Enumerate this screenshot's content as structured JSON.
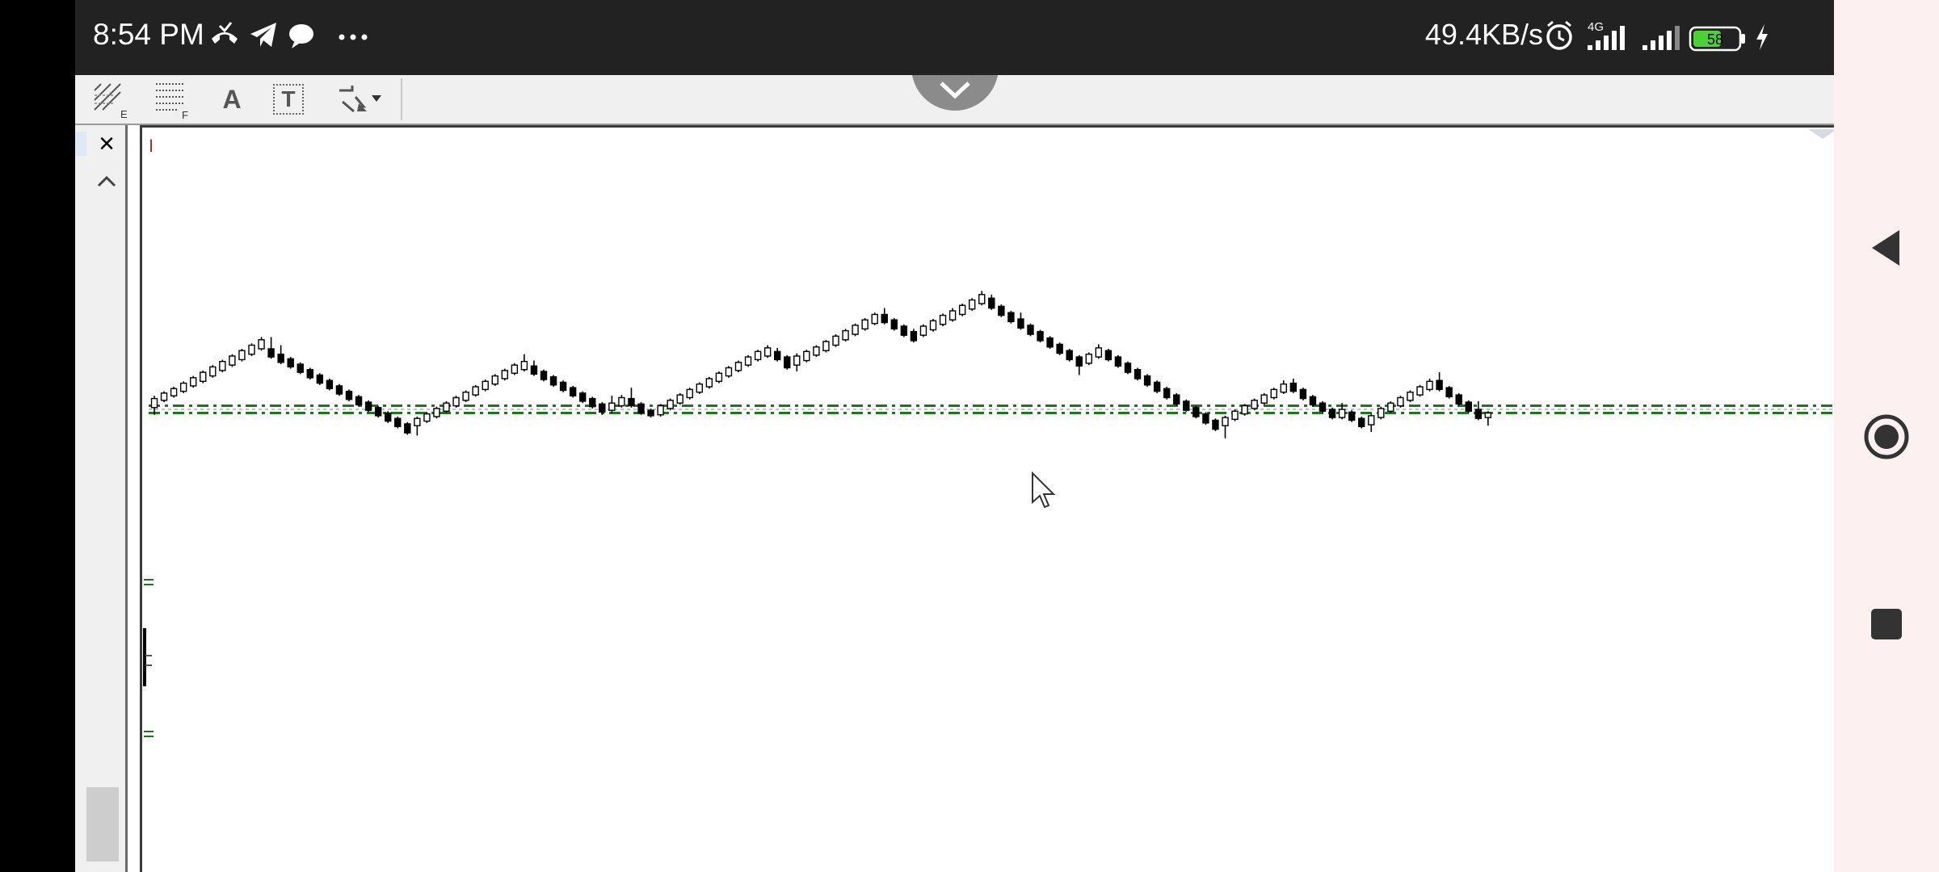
{
  "status_bar": {
    "time": "8:54 PM",
    "net_speed": "49.4KB/s",
    "network_type": "4G",
    "battery": "58",
    "icons": [
      "missed-call-icon",
      "telegram-icon",
      "chat-bubble-icon",
      "more-dots-icon",
      "alarm-icon",
      "signal-4g-icon",
      "signal-icon",
      "battery-icon",
      "charging-icon"
    ]
  },
  "toolbar": {
    "tools": [
      "fibonacci-expansion-icon",
      "fibonacci-fan-icon",
      "text-tool-icon",
      "text-label-tool-icon",
      "arrows-tool-icon"
    ],
    "text_tool_label": "A",
    "text_label_tool_label": "T"
  },
  "sidebar": {
    "close_label": "×"
  },
  "chart_data": {
    "type": "candlestick",
    "grid": false,
    "note_marker": "I",
    "horizontal_levels_color": "#1a7a1a",
    "candles": [
      {
        "o": 20,
        "c": 40,
        "h": 46,
        "l": 4
      },
      {
        "o": 36,
        "c": 52,
        "h": 56,
        "l": 32
      },
      {
        "o": 46,
        "c": 62,
        "h": 66,
        "l": 42
      },
      {
        "o": 56,
        "c": 74,
        "h": 78,
        "l": 52
      },
      {
        "o": 68,
        "c": 86,
        "h": 90,
        "l": 64
      },
      {
        "o": 78,
        "c": 98,
        "h": 102,
        "l": 74
      },
      {
        "o": 90,
        "c": 110,
        "h": 114,
        "l": 86
      },
      {
        "o": 102,
        "c": 122,
        "h": 126,
        "l": 98
      },
      {
        "o": 114,
        "c": 134,
        "h": 138,
        "l": 110
      },
      {
        "o": 126,
        "c": 146,
        "h": 150,
        "l": 122
      },
      {
        "o": 138,
        "c": 158,
        "h": 162,
        "l": 134
      },
      {
        "o": 150,
        "c": 170,
        "h": 176,
        "l": 146
      },
      {
        "o": 150,
        "c": 132,
        "h": 176,
        "l": 128
      },
      {
        "o": 138,
        "c": 120,
        "h": 158,
        "l": 116
      },
      {
        "o": 128,
        "c": 110,
        "h": 132,
        "l": 106
      },
      {
        "o": 116,
        "c": 98,
        "h": 120,
        "l": 94
      },
      {
        "o": 104,
        "c": 86,
        "h": 108,
        "l": 82
      },
      {
        "o": 92,
        "c": 74,
        "h": 96,
        "l": 70
      },
      {
        "o": 80,
        "c": 62,
        "h": 84,
        "l": 58
      },
      {
        "o": 68,
        "c": 50,
        "h": 72,
        "l": 46
      },
      {
        "o": 56,
        "c": 38,
        "h": 60,
        "l": 34
      },
      {
        "o": 44,
        "c": 26,
        "h": 48,
        "l": 22
      },
      {
        "o": 32,
        "c": 14,
        "h": 36,
        "l": 10
      },
      {
        "o": 20,
        "c": 2,
        "h": 24,
        "l": -2
      },
      {
        "o": 8,
        "c": -10,
        "h": 12,
        "l": -14
      },
      {
        "o": -4,
        "c": -22,
        "h": 0,
        "l": -26
      },
      {
        "o": -16,
        "c": -36,
        "h": -12,
        "l": -40
      },
      {
        "o": -20,
        "c": -4,
        "h": 0,
        "l": -42
      },
      {
        "o": -10,
        "c": 6,
        "h": 10,
        "l": -14
      },
      {
        "o": 0,
        "c": 18,
        "h": 22,
        "l": -4
      },
      {
        "o": 12,
        "c": 30,
        "h": 34,
        "l": 8
      },
      {
        "o": 24,
        "c": 42,
        "h": 46,
        "l": 20
      },
      {
        "o": 36,
        "c": 54,
        "h": 58,
        "l": 32
      },
      {
        "o": 48,
        "c": 66,
        "h": 70,
        "l": 44
      },
      {
        "o": 60,
        "c": 78,
        "h": 82,
        "l": 56
      },
      {
        "o": 72,
        "c": 90,
        "h": 94,
        "l": 68
      },
      {
        "o": 84,
        "c": 102,
        "h": 106,
        "l": 80
      },
      {
        "o": 96,
        "c": 114,
        "h": 118,
        "l": 92
      },
      {
        "o": 104,
        "c": 122,
        "h": 138,
        "l": 100
      },
      {
        "o": 112,
        "c": 94,
        "h": 124,
        "l": 90
      },
      {
        "o": 100,
        "c": 82,
        "h": 104,
        "l": 78
      },
      {
        "o": 88,
        "c": 70,
        "h": 92,
        "l": 66
      },
      {
        "o": 76,
        "c": 58,
        "h": 80,
        "l": 54
      },
      {
        "o": 64,
        "c": 46,
        "h": 68,
        "l": 42
      },
      {
        "o": 52,
        "c": 34,
        "h": 56,
        "l": 30
      },
      {
        "o": 40,
        "c": 22,
        "h": 44,
        "l": 18
      },
      {
        "o": 28,
        "c": 10,
        "h": 32,
        "l": 4
      },
      {
        "o": 14,
        "c": 30,
        "h": 46,
        "l": 8
      },
      {
        "o": 24,
        "c": 42,
        "h": 48,
        "l": 20
      },
      {
        "o": 40,
        "c": 24,
        "h": 64,
        "l": 20
      },
      {
        "o": 28,
        "c": 8,
        "h": 32,
        "l": 4
      },
      {
        "o": 14,
        "c": 2,
        "h": 18,
        "l": -2
      },
      {
        "o": 4,
        "c": 24,
        "h": 28,
        "l": 0
      },
      {
        "o": 18,
        "c": 36,
        "h": 40,
        "l": 14
      },
      {
        "o": 30,
        "c": 48,
        "h": 52,
        "l": 26
      },
      {
        "o": 42,
        "c": 60,
        "h": 64,
        "l": 38
      },
      {
        "o": 54,
        "c": 72,
        "h": 76,
        "l": 50
      },
      {
        "o": 66,
        "c": 84,
        "h": 88,
        "l": 62
      },
      {
        "o": 78,
        "c": 96,
        "h": 100,
        "l": 74
      },
      {
        "o": 90,
        "c": 108,
        "h": 112,
        "l": 86
      },
      {
        "o": 102,
        "c": 120,
        "h": 124,
        "l": 98
      },
      {
        "o": 114,
        "c": 132,
        "h": 136,
        "l": 110
      },
      {
        "o": 126,
        "c": 144,
        "h": 148,
        "l": 122
      },
      {
        "o": 134,
        "c": 152,
        "h": 158,
        "l": 130
      },
      {
        "o": 144,
        "c": 126,
        "h": 152,
        "l": 122
      },
      {
        "o": 132,
        "c": 108,
        "h": 136,
        "l": 104
      },
      {
        "o": 114,
        "c": 134,
        "h": 140,
        "l": 100
      },
      {
        "o": 124,
        "c": 144,
        "h": 148,
        "l": 120
      },
      {
        "o": 136,
        "c": 154,
        "h": 158,
        "l": 132
      },
      {
        "o": 146,
        "c": 166,
        "h": 170,
        "l": 142
      },
      {
        "o": 158,
        "c": 178,
        "h": 182,
        "l": 154
      },
      {
        "o": 170,
        "c": 190,
        "h": 194,
        "l": 166
      },
      {
        "o": 182,
        "c": 202,
        "h": 206,
        "l": 178
      },
      {
        "o": 194,
        "c": 214,
        "h": 218,
        "l": 190
      },
      {
        "o": 206,
        "c": 226,
        "h": 230,
        "l": 202
      },
      {
        "o": 226,
        "c": 208,
        "h": 240,
        "l": 204
      },
      {
        "o": 214,
        "c": 194,
        "h": 218,
        "l": 190
      },
      {
        "o": 200,
        "c": 180,
        "h": 204,
        "l": 176
      },
      {
        "o": 188,
        "c": 168,
        "h": 194,
        "l": 164
      },
      {
        "o": 180,
        "c": 200,
        "h": 204,
        "l": 176
      },
      {
        "o": 192,
        "c": 212,
        "h": 216,
        "l": 188
      },
      {
        "o": 204,
        "c": 224,
        "h": 228,
        "l": 200
      },
      {
        "o": 214,
        "c": 234,
        "h": 240,
        "l": 210
      },
      {
        "o": 226,
        "c": 246,
        "h": 250,
        "l": 222
      },
      {
        "o": 238,
        "c": 258,
        "h": 262,
        "l": 234
      },
      {
        "o": 250,
        "c": 270,
        "h": 278,
        "l": 246
      },
      {
        "o": 262,
        "c": 240,
        "h": 270,
        "l": 236
      },
      {
        "o": 244,
        "c": 224,
        "h": 248,
        "l": 220
      },
      {
        "o": 230,
        "c": 210,
        "h": 234,
        "l": 206
      },
      {
        "o": 216,
        "c": 196,
        "h": 230,
        "l": 192
      },
      {
        "o": 202,
        "c": 182,
        "h": 206,
        "l": 178
      },
      {
        "o": 188,
        "c": 168,
        "h": 192,
        "l": 164
      },
      {
        "o": 174,
        "c": 154,
        "h": 178,
        "l": 150
      },
      {
        "o": 160,
        "c": 140,
        "h": 164,
        "l": 136
      },
      {
        "o": 146,
        "c": 126,
        "h": 150,
        "l": 122
      },
      {
        "o": 132,
        "c": 112,
        "h": 136,
        "l": 92
      },
      {
        "o": 118,
        "c": 138,
        "h": 142,
        "l": 114
      },
      {
        "o": 132,
        "c": 152,
        "h": 160,
        "l": 128
      },
      {
        "o": 146,
        "c": 126,
        "h": 150,
        "l": 122
      },
      {
        "o": 132,
        "c": 112,
        "h": 136,
        "l": 108
      },
      {
        "o": 118,
        "c": 98,
        "h": 122,
        "l": 94
      },
      {
        "o": 104,
        "c": 84,
        "h": 108,
        "l": 80
      },
      {
        "o": 90,
        "c": 70,
        "h": 94,
        "l": 66
      },
      {
        "o": 76,
        "c": 56,
        "h": 80,
        "l": 52
      },
      {
        "o": 62,
        "c": 42,
        "h": 66,
        "l": 38
      },
      {
        "o": 48,
        "c": 28,
        "h": 52,
        "l": 24
      },
      {
        "o": 34,
        "c": 14,
        "h": 38,
        "l": 10
      },
      {
        "o": 20,
        "c": 0,
        "h": 24,
        "l": -4
      },
      {
        "o": 6,
        "c": -14,
        "h": 10,
        "l": -18
      },
      {
        "o": -8,
        "c": -28,
        "h": -4,
        "l": -32
      },
      {
        "o": -20,
        "c": -2,
        "h": 2,
        "l": -48
      },
      {
        "o": -6,
        "c": 12,
        "h": 16,
        "l": -10
      },
      {
        "o": 6,
        "c": 24,
        "h": 28,
        "l": 2
      },
      {
        "o": 18,
        "c": 36,
        "h": 40,
        "l": 14
      },
      {
        "o": 30,
        "c": 48,
        "h": 52,
        "l": 26
      },
      {
        "o": 42,
        "c": 60,
        "h": 64,
        "l": 38
      },
      {
        "o": 54,
        "c": 72,
        "h": 80,
        "l": 50
      },
      {
        "o": 74,
        "c": 56,
        "h": 84,
        "l": 52
      },
      {
        "o": 60,
        "c": 40,
        "h": 64,
        "l": 36
      },
      {
        "o": 44,
        "c": 26,
        "h": 48,
        "l": 22
      },
      {
        "o": 30,
        "c": 12,
        "h": 34,
        "l": 8
      },
      {
        "o": 16,
        "c": -2,
        "h": 20,
        "l": -6
      },
      {
        "o": -2,
        "c": 16,
        "h": 30,
        "l": -6
      },
      {
        "o": 10,
        "c": -8,
        "h": 14,
        "l": -12
      },
      {
        "o": -4,
        "c": -22,
        "h": 0,
        "l": -26
      },
      {
        "o": -18,
        "c": 2,
        "h": 6,
        "l": -34
      },
      {
        "o": -2,
        "c": 18,
        "h": 22,
        "l": -6
      },
      {
        "o": 12,
        "c": 30,
        "h": 34,
        "l": 8
      },
      {
        "o": 24,
        "c": 42,
        "h": 46,
        "l": 20
      },
      {
        "o": 36,
        "c": 54,
        "h": 58,
        "l": 32
      },
      {
        "o": 48,
        "c": 66,
        "h": 70,
        "l": 44
      },
      {
        "o": 60,
        "c": 78,
        "h": 84,
        "l": 56
      },
      {
        "o": 80,
        "c": 60,
        "h": 98,
        "l": 56
      },
      {
        "o": 64,
        "c": 44,
        "h": 68,
        "l": 40
      },
      {
        "o": 48,
        "c": 28,
        "h": 52,
        "l": 24
      },
      {
        "o": 32,
        "c": 12,
        "h": 36,
        "l": 8
      },
      {
        "o": 16,
        "c": -4,
        "h": 34,
        "l": -8
      },
      {
        "o": -2,
        "c": 8,
        "h": 12,
        "l": -20
      }
    ],
    "levels": [
      {
        "value": 24,
        "style": "dash-dot",
        "color": "#1a7a1a"
      },
      {
        "value": 16,
        "style": "dotted",
        "color": "#a8a8c8"
      },
      {
        "value": 8,
        "style": "dash-dot",
        "color": "#1a7a1a"
      }
    ],
    "ylim": [
      -80,
      330
    ]
  },
  "nav_bar": {
    "buttons": [
      "back-button",
      "home-button",
      "recents-button"
    ]
  }
}
